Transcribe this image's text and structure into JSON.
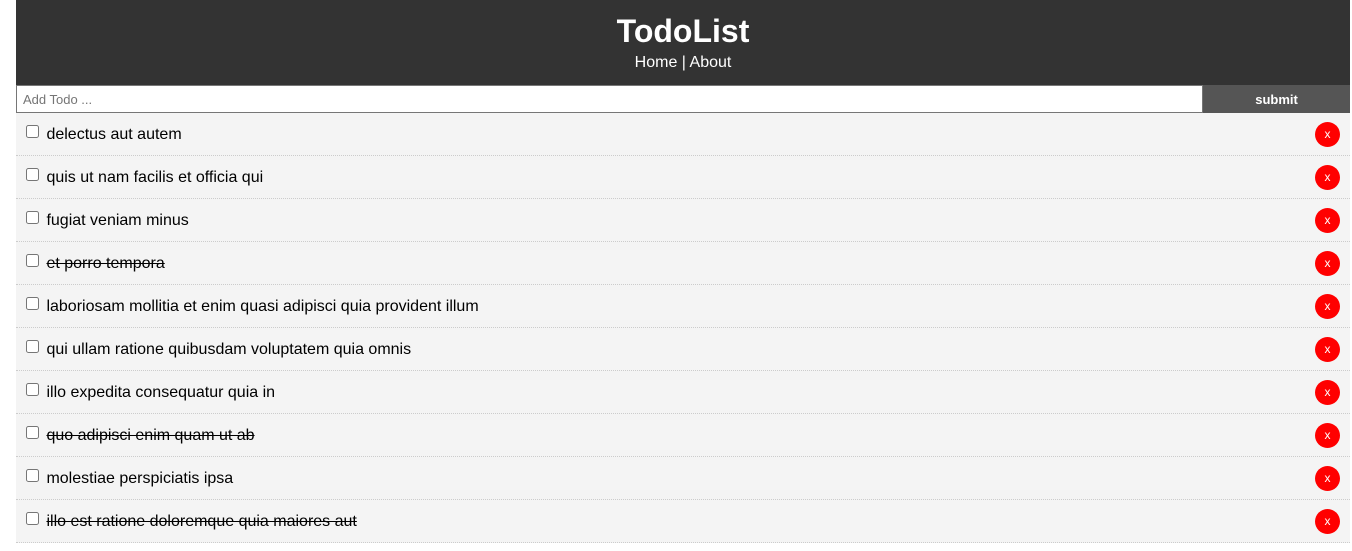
{
  "header": {
    "title": "TodoList",
    "nav": {
      "home": "Home",
      "separator": " | ",
      "about": "About"
    }
  },
  "form": {
    "placeholder": "Add Todo ...",
    "value": "",
    "submit_label": "submit"
  },
  "colors": {
    "header_bg": "#333333",
    "submit_bg": "#555555",
    "delete_bg": "#ff0000",
    "item_bg": "#f4f4f4"
  },
  "todos": [
    {
      "title": "delectus aut autem",
      "completed": false,
      "delete_label": "x"
    },
    {
      "title": "quis ut nam facilis et officia qui",
      "completed": false,
      "delete_label": "x"
    },
    {
      "title": "fugiat veniam minus",
      "completed": false,
      "delete_label": "x"
    },
    {
      "title": "et porro tempora",
      "completed": true,
      "delete_label": "x"
    },
    {
      "title": "laboriosam mollitia et enim quasi adipisci quia provident illum",
      "completed": false,
      "delete_label": "x"
    },
    {
      "title": "qui ullam ratione quibusdam voluptatem quia omnis",
      "completed": false,
      "delete_label": "x"
    },
    {
      "title": "illo expedita consequatur quia in",
      "completed": false,
      "delete_label": "x"
    },
    {
      "title": "quo adipisci enim quam ut ab",
      "completed": true,
      "delete_label": "x"
    },
    {
      "title": "molestiae perspiciatis ipsa",
      "completed": false,
      "delete_label": "x"
    },
    {
      "title": "illo est ratione doloremque quia maiores aut",
      "completed": true,
      "delete_label": "x"
    }
  ]
}
